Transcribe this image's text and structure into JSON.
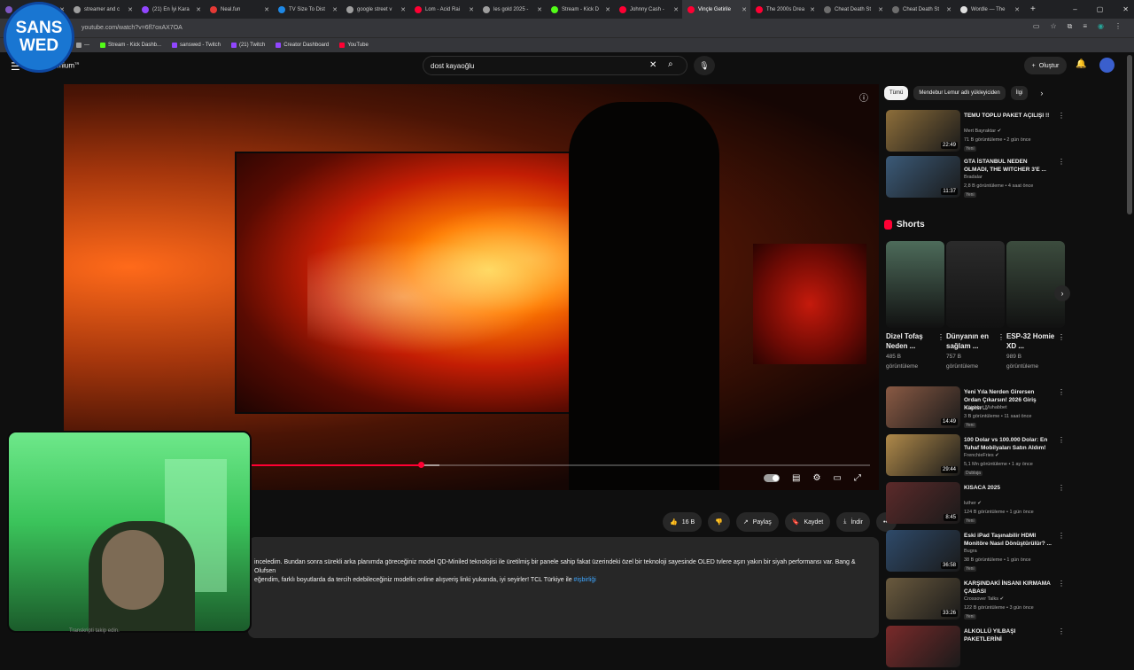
{
  "browser": {
    "tabs": [
      {
        "title": "",
        "color": "#7e57c2"
      },
      {
        "title": "streamer and c",
        "color": "#9e9e9e"
      },
      {
        "title": "(21) En İyi Kara",
        "color": "#9146ff"
      },
      {
        "title": "Neal.fun",
        "color": "#e53935"
      },
      {
        "title": "TV Size To Dist",
        "color": "#1e88e5"
      },
      {
        "title": "google street v",
        "color": "#9e9e9e"
      },
      {
        "title": "Lom - Acid Rai",
        "color": "#ff0033"
      },
      {
        "title": "les gold 2025 -",
        "color": "#9e9e9e"
      },
      {
        "title": "Stream - Kick D",
        "color": "#53fc18"
      },
      {
        "title": "Johnny Cash -",
        "color": "#ff0033"
      },
      {
        "title": "Vinçle Getirile",
        "color": "#ff0033"
      },
      {
        "title": "The 2000s Drea",
        "color": "#ff0033"
      },
      {
        "title": "Cheat Death St",
        "color": "#6d6d6d"
      },
      {
        "title": "Cheat Death St",
        "color": "#6d6d6d"
      },
      {
        "title": "Wordle — The",
        "color": "#e0e0e0"
      }
    ],
    "active_tab_index": 10,
    "new_tab": "+",
    "window_controls": [
      "–",
      "▢",
      "✕"
    ],
    "url": "youtube.com/watch?v=6fl7oxAX7OA",
    "bookmarks": [
      {
        "label": "—",
        "color": "#9e9e9e"
      },
      {
        "label": "Stream - Kick Dashb...",
        "color": "#53fc18"
      },
      {
        "label": "sanswed - Twitch",
        "color": "#9146ff"
      },
      {
        "label": "(21) Twitch",
        "color": "#9146ff"
      },
      {
        "label": "Creator Dashboard",
        "color": "#9146ff"
      },
      {
        "label": "YouTube",
        "color": "#ff0033"
      }
    ]
  },
  "streamer_badge": {
    "line1": "SANS",
    "line2": "WED"
  },
  "youtube": {
    "brand": "emium",
    "brand_sup": "TR",
    "search_value": "dost kayaoğlu",
    "create_label": "Oluştur",
    "create_plus": "+"
  },
  "player": {
    "progress_played": 0.275,
    "progress_buffer_end": 0.305,
    "info_icon": "ⓘ"
  },
  "actions": {
    "likes": "16 B",
    "share": "Paylaş",
    "save": "Kaydet",
    "download": "İndir",
    "more": "•••"
  },
  "description": {
    "line1": "inceledim. Bundan sonra sürekli arka planımda göreceğiniz model QD-Miniled teknolojisi ile üretilmiş bir panele sahip fakat üzerindeki özel bir teknoloji sayesinde OLED tvlere aşırı yakın bir siyah performansı var. Bang & Olufsen",
    "line2": "eğendim, farklı boyutlarda da tercih edebileceğiniz modelin online alışveriş linki yukarıda, iyi seyirler! TCL Türkiye ile",
    "hashtag": "#işbirliği"
  },
  "transcript_hint": "Transkripti takip edin.",
  "sidebar": {
    "chips": [
      "Tümü",
      "Mendebur Lemur adlı yükleyiciden",
      "İlgi"
    ],
    "chip_next": "›",
    "top_videos": [
      {
        "title": "TEMU TOPLU PAKET AÇILIŞI !!",
        "channel": "Mert Bayraktar ✔",
        "meta": "71 B görüntüleme • 2 gün önce",
        "badge": "Yeni",
        "duration": "22:49",
        "thumb": "#8d6e3a"
      },
      {
        "title": "GTA İSTANBUL NEDEN OLMADI, THE WITCHER 3'E ...",
        "channel": "Bradalar",
        "meta": "2,8 B görüntüleme • 4 saat önce",
        "badge": "Yeni",
        "duration": "11:37",
        "thumb": "#3b5a78"
      }
    ],
    "shorts_title": "Shorts",
    "shorts_next": "›",
    "shorts": [
      {
        "title": "Dizel Tofaş Neden ...",
        "views": "485 B",
        "views_label": "görüntüleme",
        "thumb": "#4d6b5a"
      },
      {
        "title": "Dünyanın en sağlam ...",
        "views": "757 B",
        "views_label": "görüntüleme",
        "thumb": "#2b2b2b"
      },
      {
        "title": "ESP-32 Homie XD ...",
        "views": "989 B",
        "views_label": "görüntüleme",
        "thumb": "#3c4c3e"
      }
    ],
    "more_videos": [
      {
        "title": "Yeni Yıla Nerden Girersen Ordan Çıkarsın! 2026 Giriş Kapısı ...",
        "channel": "Müjebbet Muhabbet",
        "meta": "3 B görüntüleme • 11 saat önce",
        "badge": "Yeni",
        "duration": "14:49",
        "thumb": "#8a5a44"
      },
      {
        "title": "100 Dolar vs 100.000 Dolar: En Tuhaf Mobilyaları Satın Aldım!",
        "channel": "FrenchieFries ✔",
        "meta": "5,1 Mn görüntüleme • 1 ay önce",
        "badge": "Dublaja",
        "duration": "29:44",
        "thumb": "#b08a4a"
      },
      {
        "title": "KISACA 2025",
        "channel": "luther ✔",
        "meta": "124 B görüntüleme • 1 gün önce",
        "badge": "Yeni",
        "duration": "8:45",
        "thumb": "#5c2a2a"
      },
      {
        "title": "Eski iPad Taşınabilir HDMI Monitöre Nasıl Dönüştürülür? ...",
        "channel": "Bugra",
        "meta": "38 B görüntüleme • 1 gün önce",
        "badge": "Yeni",
        "duration": "36:58",
        "thumb": "#2e4a6a"
      },
      {
        "title": "KARŞINDAKİ İNSANI KIRMAMA ÇABASI",
        "channel": "Crossover Talks ✔",
        "meta": "122 B görüntüleme • 3 gün önce",
        "badge": "Yeni",
        "duration": "33:26",
        "thumb": "#6a5a3e"
      },
      {
        "title": "ALKOLLÜ YILBAŞI PAKETLERİNİ",
        "channel": "",
        "meta": "",
        "badge": "",
        "duration": "",
        "thumb": "#7a2a2a"
      }
    ]
  }
}
